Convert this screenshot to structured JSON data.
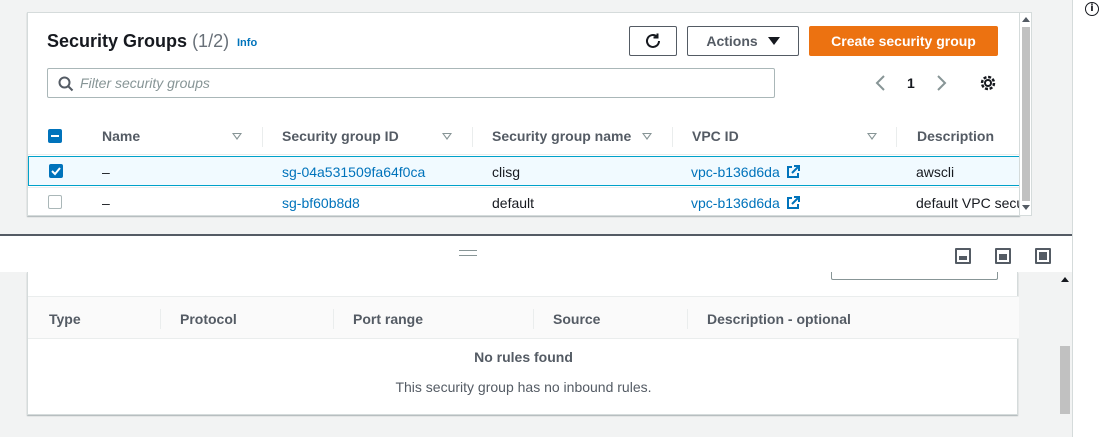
{
  "header": {
    "title": "Security Groups",
    "count": "(1/2)",
    "info": "Info"
  },
  "toolbar": {
    "actions_label": "Actions",
    "create_label": "Create security group"
  },
  "search": {
    "placeholder": "Filter security groups"
  },
  "pagination": {
    "current_page": "1"
  },
  "table": {
    "columns": [
      "Name",
      "Security group ID",
      "Security group name",
      "VPC ID",
      "Description"
    ],
    "rows": [
      {
        "selected": true,
        "name": "–",
        "sg_id": "sg-04a531509fa64f0ca",
        "sg_name": "clisg",
        "vpc_id": "vpc-b136d6da",
        "description": "awscli"
      },
      {
        "selected": false,
        "name": "–",
        "sg_id": "sg-bf60b8d8",
        "sg_name": "default",
        "vpc_id": "vpc-b136d6da",
        "description": "default VPC secu"
      }
    ]
  },
  "inbound_rules": {
    "columns": [
      "Type",
      "Protocol",
      "Port range",
      "Source",
      "Description - optional"
    ],
    "empty_title": "No rules found",
    "empty_message": "This security group has no inbound rules."
  },
  "info_icon_label": "i",
  "colors": {
    "primary": "#ec7211",
    "link": "#0073bb",
    "selected_row_bg": "#f1faff",
    "selected_row_border": "#00a1c9"
  },
  "icons": [
    "refresh-icon",
    "caret-down-icon",
    "search-icon",
    "chevron-left-icon",
    "chevron-right-icon",
    "settings-icon",
    "external-link-icon",
    "info-circle-icon",
    "panel-layout-icons"
  ]
}
